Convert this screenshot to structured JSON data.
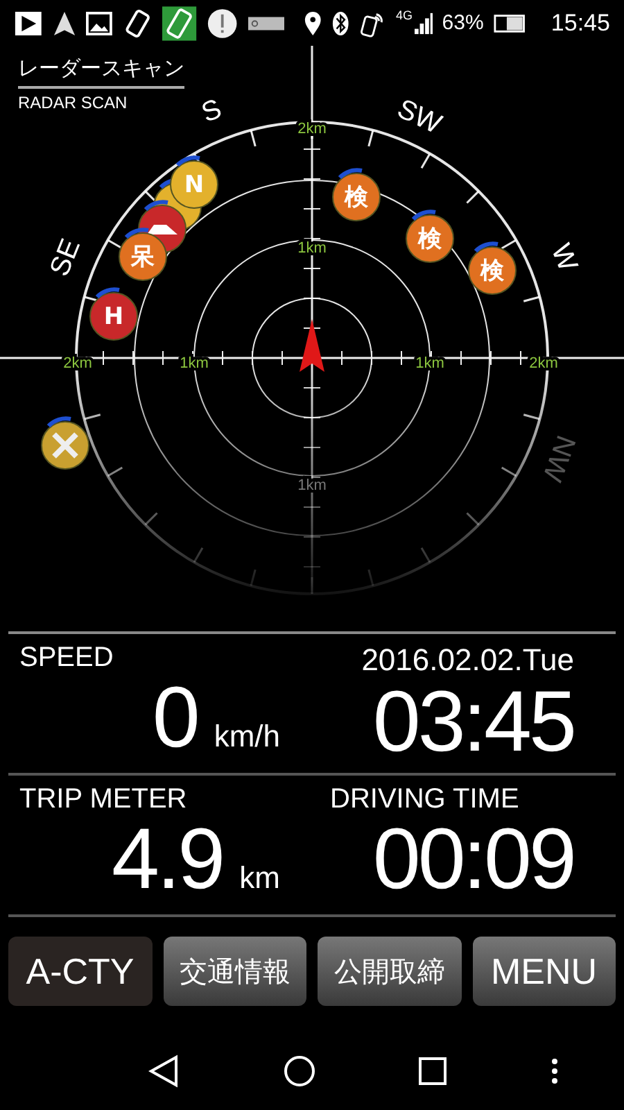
{
  "status_bar": {
    "network": "4G",
    "battery": "63%",
    "time": "15:45"
  },
  "title": {
    "japanese": "レーダースキャン",
    "english": "RADAR SCAN"
  },
  "radar": {
    "compass": [
      {
        "label": "S"
      },
      {
        "label": "SW"
      },
      {
        "label": "W"
      },
      {
        "label": "SE"
      },
      {
        "label": "NW"
      }
    ],
    "range_labels": [
      "2km",
      "1km",
      "2km",
      "1km",
      "1km",
      "2km",
      "1km"
    ],
    "markers": [
      {
        "kind": "blank",
        "color": "#e3b12c"
      },
      {
        "kind": "text",
        "text": "N",
        "color": "#e3b12c"
      },
      {
        "kind": "car",
        "color": "#c8282a"
      },
      {
        "kind": "text",
        "text": "呆",
        "color": "#e07020"
      },
      {
        "kind": "text",
        "text": "H",
        "color": "#c8282a"
      },
      {
        "kind": "cross",
        "color": "#c9a030"
      },
      {
        "kind": "text",
        "text": "検",
        "color": "#e07020"
      },
      {
        "kind": "text",
        "text": "検",
        "color": "#e07020"
      },
      {
        "kind": "text",
        "text": "検",
        "color": "#e07020"
      }
    ]
  },
  "speed": {
    "label": "SPEED",
    "value": "0",
    "unit": "km/h"
  },
  "date": "2016.02.02.Tue",
  "clock": "03:45",
  "trip": {
    "label": "TRIP METER",
    "value": "4.9",
    "unit": "km"
  },
  "driving_time": {
    "label": "DRIVING TIME",
    "value": "00:09"
  },
  "buttons": [
    {
      "label": "A-CTY",
      "selected": true
    },
    {
      "label": "交通情報",
      "selected": false
    },
    {
      "label": "公開取締",
      "selected": false
    },
    {
      "label": "MENU",
      "selected": false
    }
  ]
}
